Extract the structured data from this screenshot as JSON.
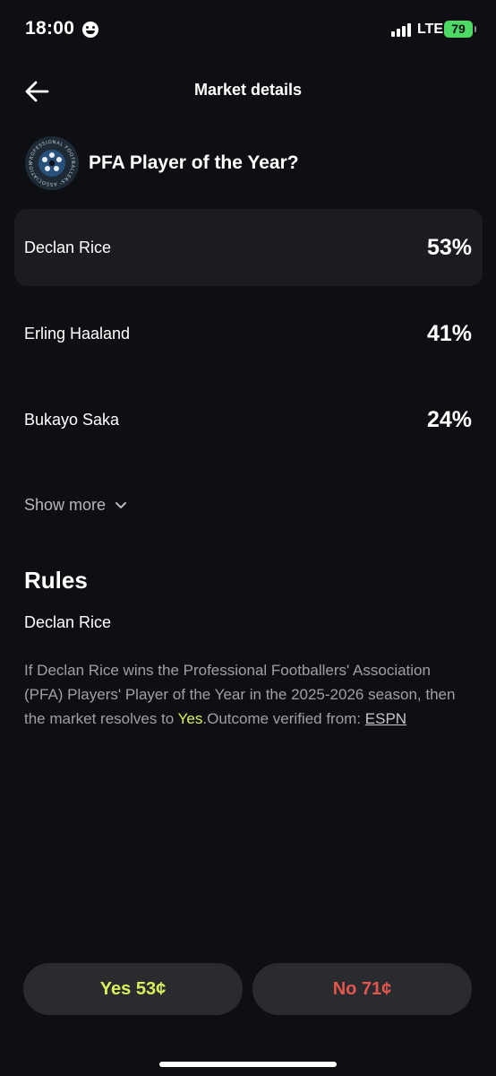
{
  "status_bar": {
    "time": "18:00",
    "network": "LTE",
    "battery": "79"
  },
  "header": {
    "title": "Market details"
  },
  "market": {
    "title": "PFA Player of the Year?",
    "logo_ring_text": "PROFESSIONAL FOOTBALLERS' ASSOCIATION"
  },
  "outcomes": [
    {
      "name": "Declan Rice",
      "percent": "53%"
    },
    {
      "name": "Erling Haaland",
      "percent": "41%"
    },
    {
      "name": "Bukayo Saka",
      "percent": "24%"
    }
  ],
  "show_more_label": "Show more",
  "rules": {
    "title": "Rules",
    "subtitle": "Declan Rice",
    "body": "If Declan Rice wins the Professional Footballers' Association (PFA) Players' Player of the Year in the 2025-2026 season, then the market resolves to ",
    "yes_word": "Yes",
    "verified_prefix": ".Outcome verified from: ",
    "source_link": "ESPN"
  },
  "buttons": {
    "yes": "Yes 53¢",
    "no": "No 71¢"
  },
  "colors": {
    "background": "#0e0f13",
    "accent_yes": "#d9f15a",
    "accent_no": "#e4564e",
    "battery": "#4cd964"
  }
}
